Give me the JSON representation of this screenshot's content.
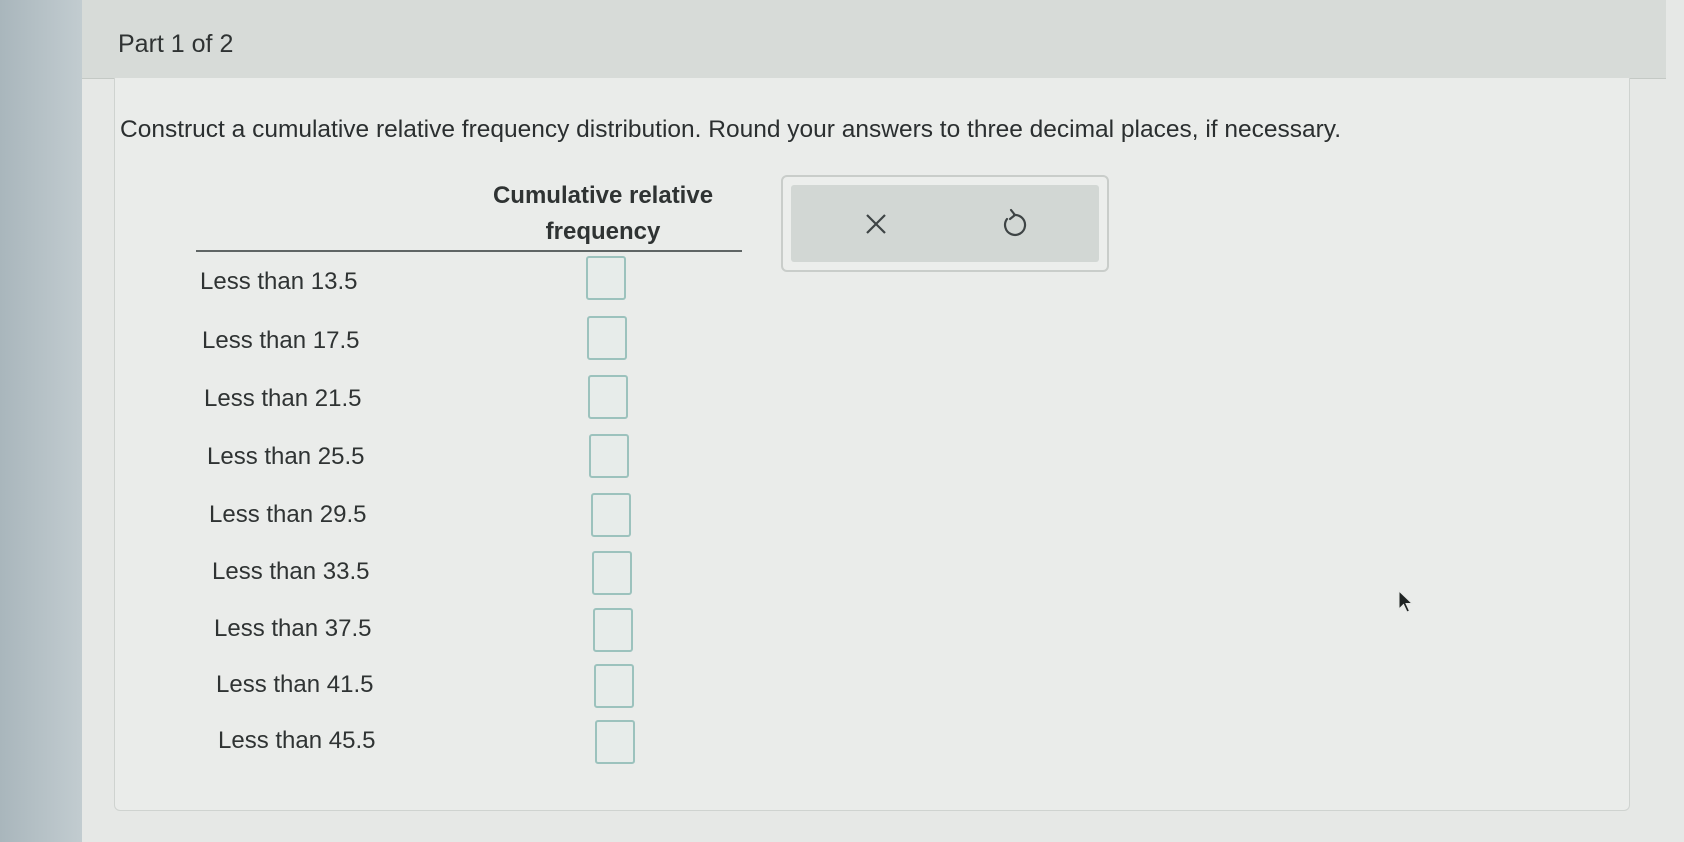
{
  "part": {
    "title": "Part 1 of 2"
  },
  "question": {
    "instruction": "Construct a cumulative relative frequency distribution. Round your answers to three decimal places, if necessary."
  },
  "table": {
    "column_header_line1": "Cumulative relative",
    "column_header_line2": "frequency",
    "rows": [
      {
        "label": "Less than 13.5",
        "value": ""
      },
      {
        "label": "Less than 17.5",
        "value": ""
      },
      {
        "label": "Less than 21.5",
        "value": ""
      },
      {
        "label": "Less than 25.5",
        "value": ""
      },
      {
        "label": "Less than 29.5",
        "value": ""
      },
      {
        "label": "Less than 33.5",
        "value": ""
      },
      {
        "label": "Less than 37.5",
        "value": ""
      },
      {
        "label": "Less than 41.5",
        "value": ""
      },
      {
        "label": "Less than 45.5",
        "value": ""
      }
    ]
  },
  "tools": {
    "clear_icon": "close-icon",
    "undo_icon": "undo-icon"
  },
  "colors": {
    "answer_box_border": "#9cc2bd",
    "tool_panel_bg": "#d2d7d4"
  }
}
